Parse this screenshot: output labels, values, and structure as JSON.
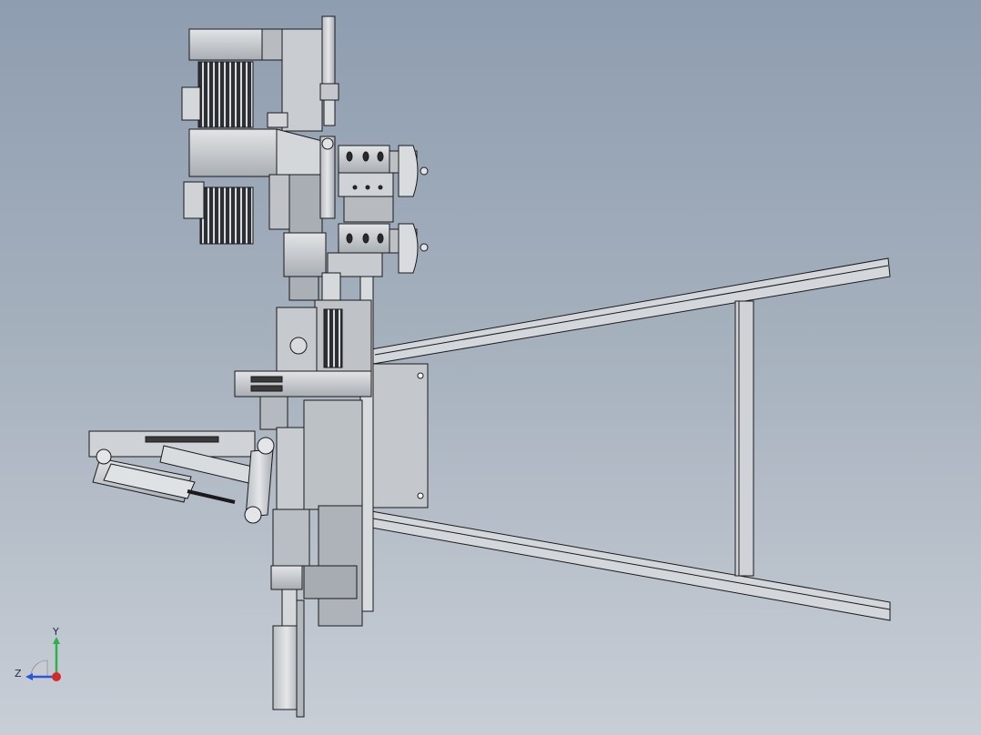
{
  "viewport": {
    "background_top": "#8e9db0",
    "background_bottom": "#c8ced6"
  },
  "model": {
    "parts": [
      "motor-gearbox-assembly",
      "vertical-spindle",
      "clamp-block-upper",
      "clamp-block-lower",
      "vertical-mounting-plate",
      "horizontal-frame-rails",
      "frame-crossbar",
      "pneumatic-cylinder",
      "linkage-arm",
      "lower-actuator"
    ],
    "line_color": "#1a1a1a",
    "part_fill": "#cfd2d6",
    "part_fill_dark": "#9ea3a9"
  },
  "triad": {
    "y_label": "Y",
    "z_label": "Z",
    "y_color": "#2bb34a",
    "z_color": "#2a55d6",
    "x_color": "#d62a2a"
  }
}
